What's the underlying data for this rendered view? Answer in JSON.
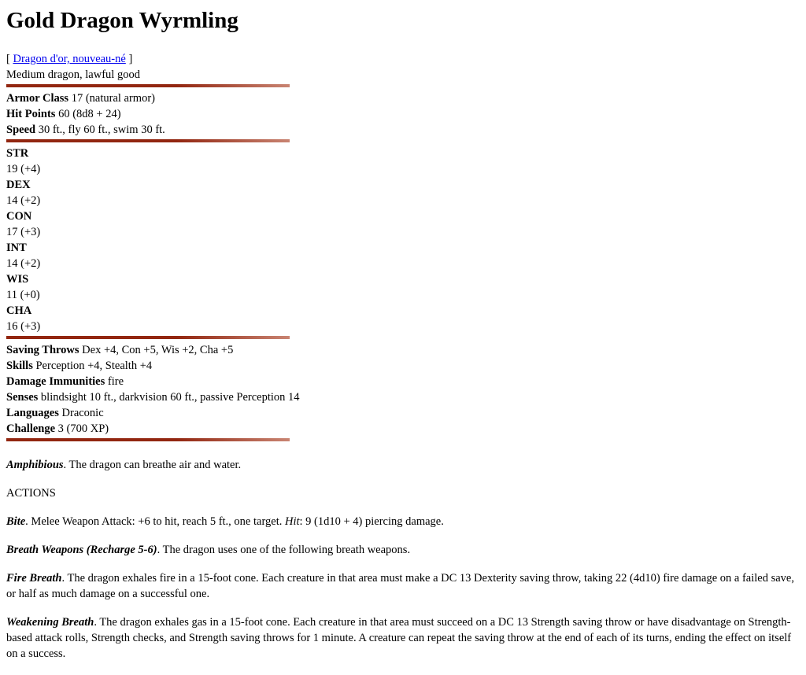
{
  "title": "Gold Dragon Wyrmling",
  "alt_name": {
    "open": "[ ",
    "link": "Dragon d'or, nouveau-né",
    "close": " ]"
  },
  "type_line": "Medium dragon, lawful good",
  "basics": [
    {
      "label": "Armor Class",
      "value": " 17 (natural armor)"
    },
    {
      "label": "Hit Points",
      "value": " 60 (8d8 + 24)"
    },
    {
      "label": "Speed",
      "value": " 30 ft., fly 60 ft., swim 30 ft."
    }
  ],
  "abilities": [
    {
      "label": "STR",
      "value": "19 (+4)"
    },
    {
      "label": "DEX",
      "value": "14 (+2)"
    },
    {
      "label": "CON",
      "value": "17 (+3)"
    },
    {
      "label": "INT",
      "value": "14 (+2)"
    },
    {
      "label": "WIS",
      "value": "11 (+0)"
    },
    {
      "label": "CHA",
      "value": "16 (+3)"
    }
  ],
  "details": [
    {
      "label": "Saving Throws",
      "value": " Dex +4, Con +5, Wis +2, Cha +5"
    },
    {
      "label": "Skills",
      "value": " Perception +4, Stealth +4"
    },
    {
      "label": "Damage Immunities",
      "value": " fire"
    },
    {
      "label": "Senses",
      "value": " blindsight 10 ft., darkvision 60 ft., passive Perception 14"
    },
    {
      "label": "Languages",
      "value": " Draconic"
    },
    {
      "label": "Challenge",
      "value": " 3 (700 XP)"
    }
  ],
  "traits": {
    "amphibious": {
      "name": "Amphibious",
      "text": ". The dragon can breathe air and water."
    }
  },
  "actions_heading": "ACTIONS",
  "actions": {
    "bite": {
      "name": "Bite",
      "text1": ". Melee Weapon Attack: +6 to hit, reach 5 ft., one target. ",
      "hit_label": "Hit",
      "text2": ": 9 (1d10 + 4) piercing damage."
    },
    "breath_weapons": {
      "name": "Breath Weapons (Recharge 5-6)",
      "text": ". The dragon uses one of the following breath weapons."
    },
    "fire_breath": {
      "name": "Fire Breath",
      "text": ". The dragon exhales fire in a 15-foot cone. Each creature in that area must make a DC 13 Dexterity saving throw, taking 22 (4d10) fire damage on a failed save, or half as much damage on a successful one."
    },
    "weakening_breath": {
      "name": "Weakening Breath",
      "text": ". The dragon exhales gas in a 15-foot cone. Each creature in that area must succeed on a DC 13 Strength saving throw or have disadvantage on Strength-based attack rolls, Strength checks, and Strength saving throws for 1 minute. A creature can repeat the saving throw at the end of each of its turns, ending the effect on itself on a success."
    }
  },
  "colors": {
    "rule": "#922610",
    "link": "#0000ee"
  }
}
